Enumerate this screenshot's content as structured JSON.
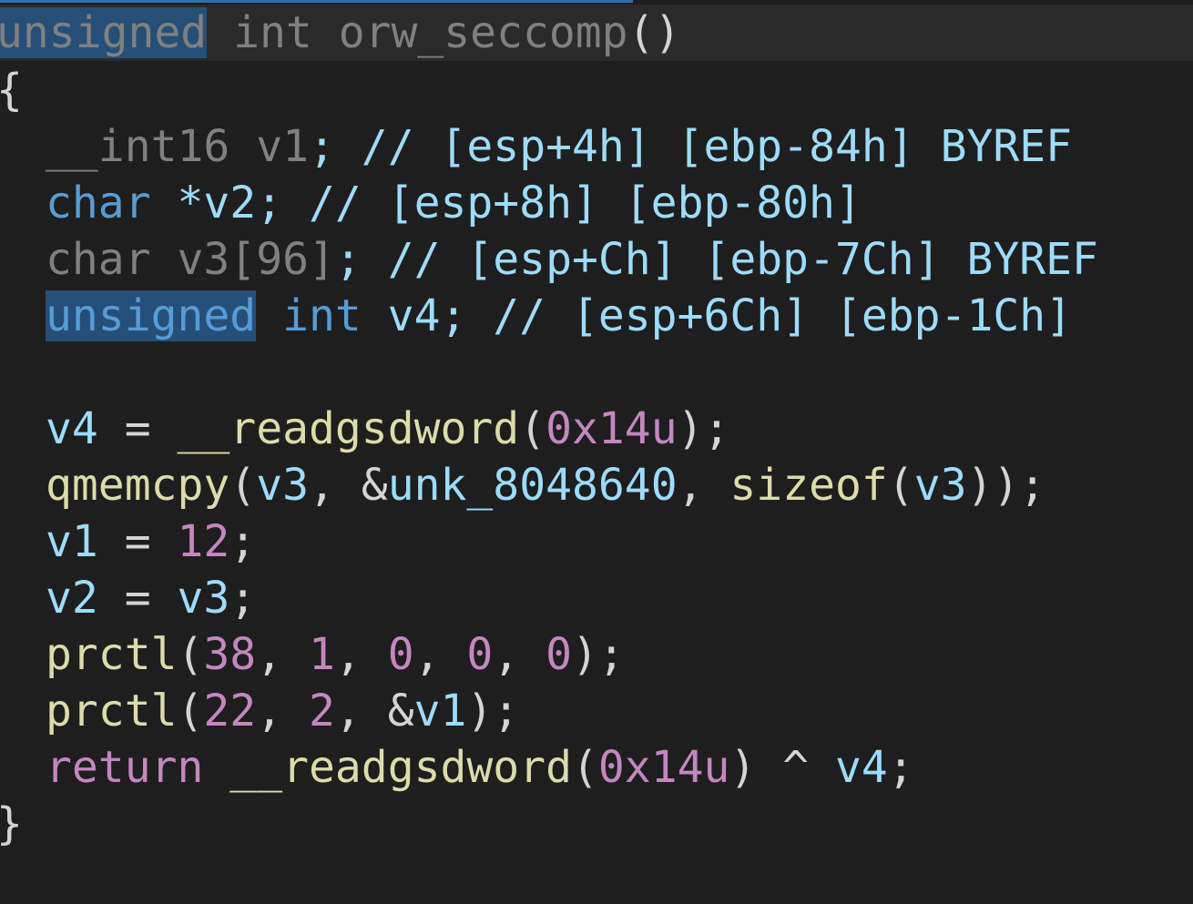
{
  "editor": {
    "signature": {
      "kw_unsigned": "unsigned",
      "kw_int": " int ",
      "func_name": "orw_seccomp",
      "parens": "()"
    },
    "open_brace": "{",
    "close_brace": "}",
    "decls": [
      {
        "type": "__int16",
        "name": " v1",
        "rest": "; // [esp+4h] [ebp-84h] BYREF"
      },
      {
        "type": "char",
        "name": " *v2",
        "rest": "; // [esp+8h] [ebp-80h]"
      },
      {
        "type": "char",
        "name": " v3",
        "bracket": "[96]",
        "rest": "; // [esp+Ch] [ebp-7Ch] BYREF"
      },
      {
        "type_hl": "unsigned",
        "type": " int",
        "name": " v4",
        "rest": "; // [esp+6Ch] [ebp-1Ch]"
      }
    ],
    "stmts": {
      "s1": {
        "lhs": "v4",
        "op": " = ",
        "fn": "__readgsdword",
        "open": "(",
        "arg": "0x14u",
        "close": ");"
      },
      "s2": {
        "fn": "qmemcpy",
        "open": "(",
        "a1": "v3",
        "sep1": ", &",
        "a2": "unk_8048640",
        "sep2": ", ",
        "fn2": "sizeof",
        "open2": "(",
        "a3": "v3",
        "close": "));"
      },
      "s3": {
        "lhs": "v1",
        "op": " = ",
        "val": "12",
        "end": ";"
      },
      "s4": {
        "lhs": "v2",
        "op": " = ",
        "rhs": "v3",
        "end": ";"
      },
      "s5": {
        "fn": "prctl",
        "open": "(",
        "n1": "38",
        "c1": ", ",
        "n2": "1",
        "c2": ", ",
        "n3": "0",
        "c3": ", ",
        "n4": "0",
        "c4": ", ",
        "n5": "0",
        "close": ");"
      },
      "s6": {
        "fn": "prctl",
        "open": "(",
        "n1": "22",
        "c1": ", ",
        "n2": "2",
        "c2": ", &",
        "v": "v1",
        "close": ");"
      },
      "s7": {
        "kw": "return",
        "sp": " ",
        "fn": "__readgsdword",
        "open": "(",
        "arg": "0x14u",
        "close": ") ^ ",
        "v": "v4",
        "end": ";"
      }
    }
  },
  "colors": {
    "background": "#1e1e1e",
    "keyword": "#569cd6",
    "control": "#c586c0",
    "variable": "#9cdcfe",
    "function": "#dcdcaa",
    "number": "#b5cea8",
    "selection": "#264f78"
  }
}
